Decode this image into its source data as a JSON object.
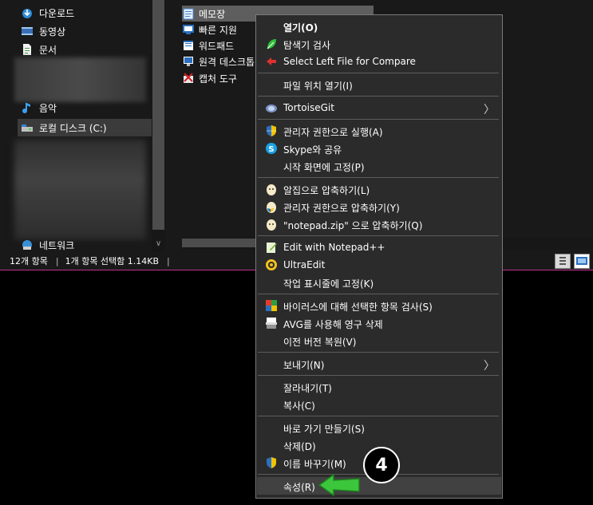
{
  "nav": {
    "items": [
      {
        "label": "다운로드"
      },
      {
        "label": "동영상"
      },
      {
        "label": "문서"
      },
      {
        "label": "음악"
      },
      {
        "label": "로컬 디스크 (C:)"
      },
      {
        "label": "네트워크"
      }
    ]
  },
  "files": {
    "items": [
      {
        "label": "메모장"
      },
      {
        "label": "빠른 지원"
      },
      {
        "label": "워드패드"
      },
      {
        "label": "원격 데스크톱"
      },
      {
        "label": "캡처 도구"
      }
    ]
  },
  "status": {
    "count": "12개 항목",
    "selection": "1개 항목 선택함 1.14KB"
  },
  "menu": {
    "items": [
      {
        "label": "열기(O)"
      },
      {
        "label": "탐색기 검사"
      },
      {
        "label": "Select Left File for Compare"
      },
      {
        "label": "파일 위치 열기(I)"
      },
      {
        "label": "TortoiseGit"
      },
      {
        "label": "관리자 권한으로 실행(A)"
      },
      {
        "label": "Skype와 공유"
      },
      {
        "label": "시작 화면에 고정(P)"
      },
      {
        "label": "알집으로 압축하기(L)"
      },
      {
        "label": "관리자 권한으로 압축하기(Y)"
      },
      {
        "label": "\"notepad.zip\" 으로 압축하기(Q)"
      },
      {
        "label": "Edit with Notepad++"
      },
      {
        "label": "UltraEdit"
      },
      {
        "label": "작업 표시줄에 고정(K)"
      },
      {
        "label": "바이러스에 대해 선택한 항목 검사(S)"
      },
      {
        "label": "AVG를 사용해 영구 삭제"
      },
      {
        "label": "이전 버전 복원(V)"
      },
      {
        "label": "보내기(N)"
      },
      {
        "label": "잘라내기(T)"
      },
      {
        "label": "복사(C)"
      },
      {
        "label": "바로 가기 만들기(S)"
      },
      {
        "label": "삭제(D)"
      },
      {
        "label": "이름 바꾸기(M)"
      },
      {
        "label": "속성(R)"
      }
    ]
  },
  "callout": {
    "number": "4"
  },
  "colors": {
    "accent_border": "#c1308f",
    "arrow_green": "#3cc63c"
  }
}
